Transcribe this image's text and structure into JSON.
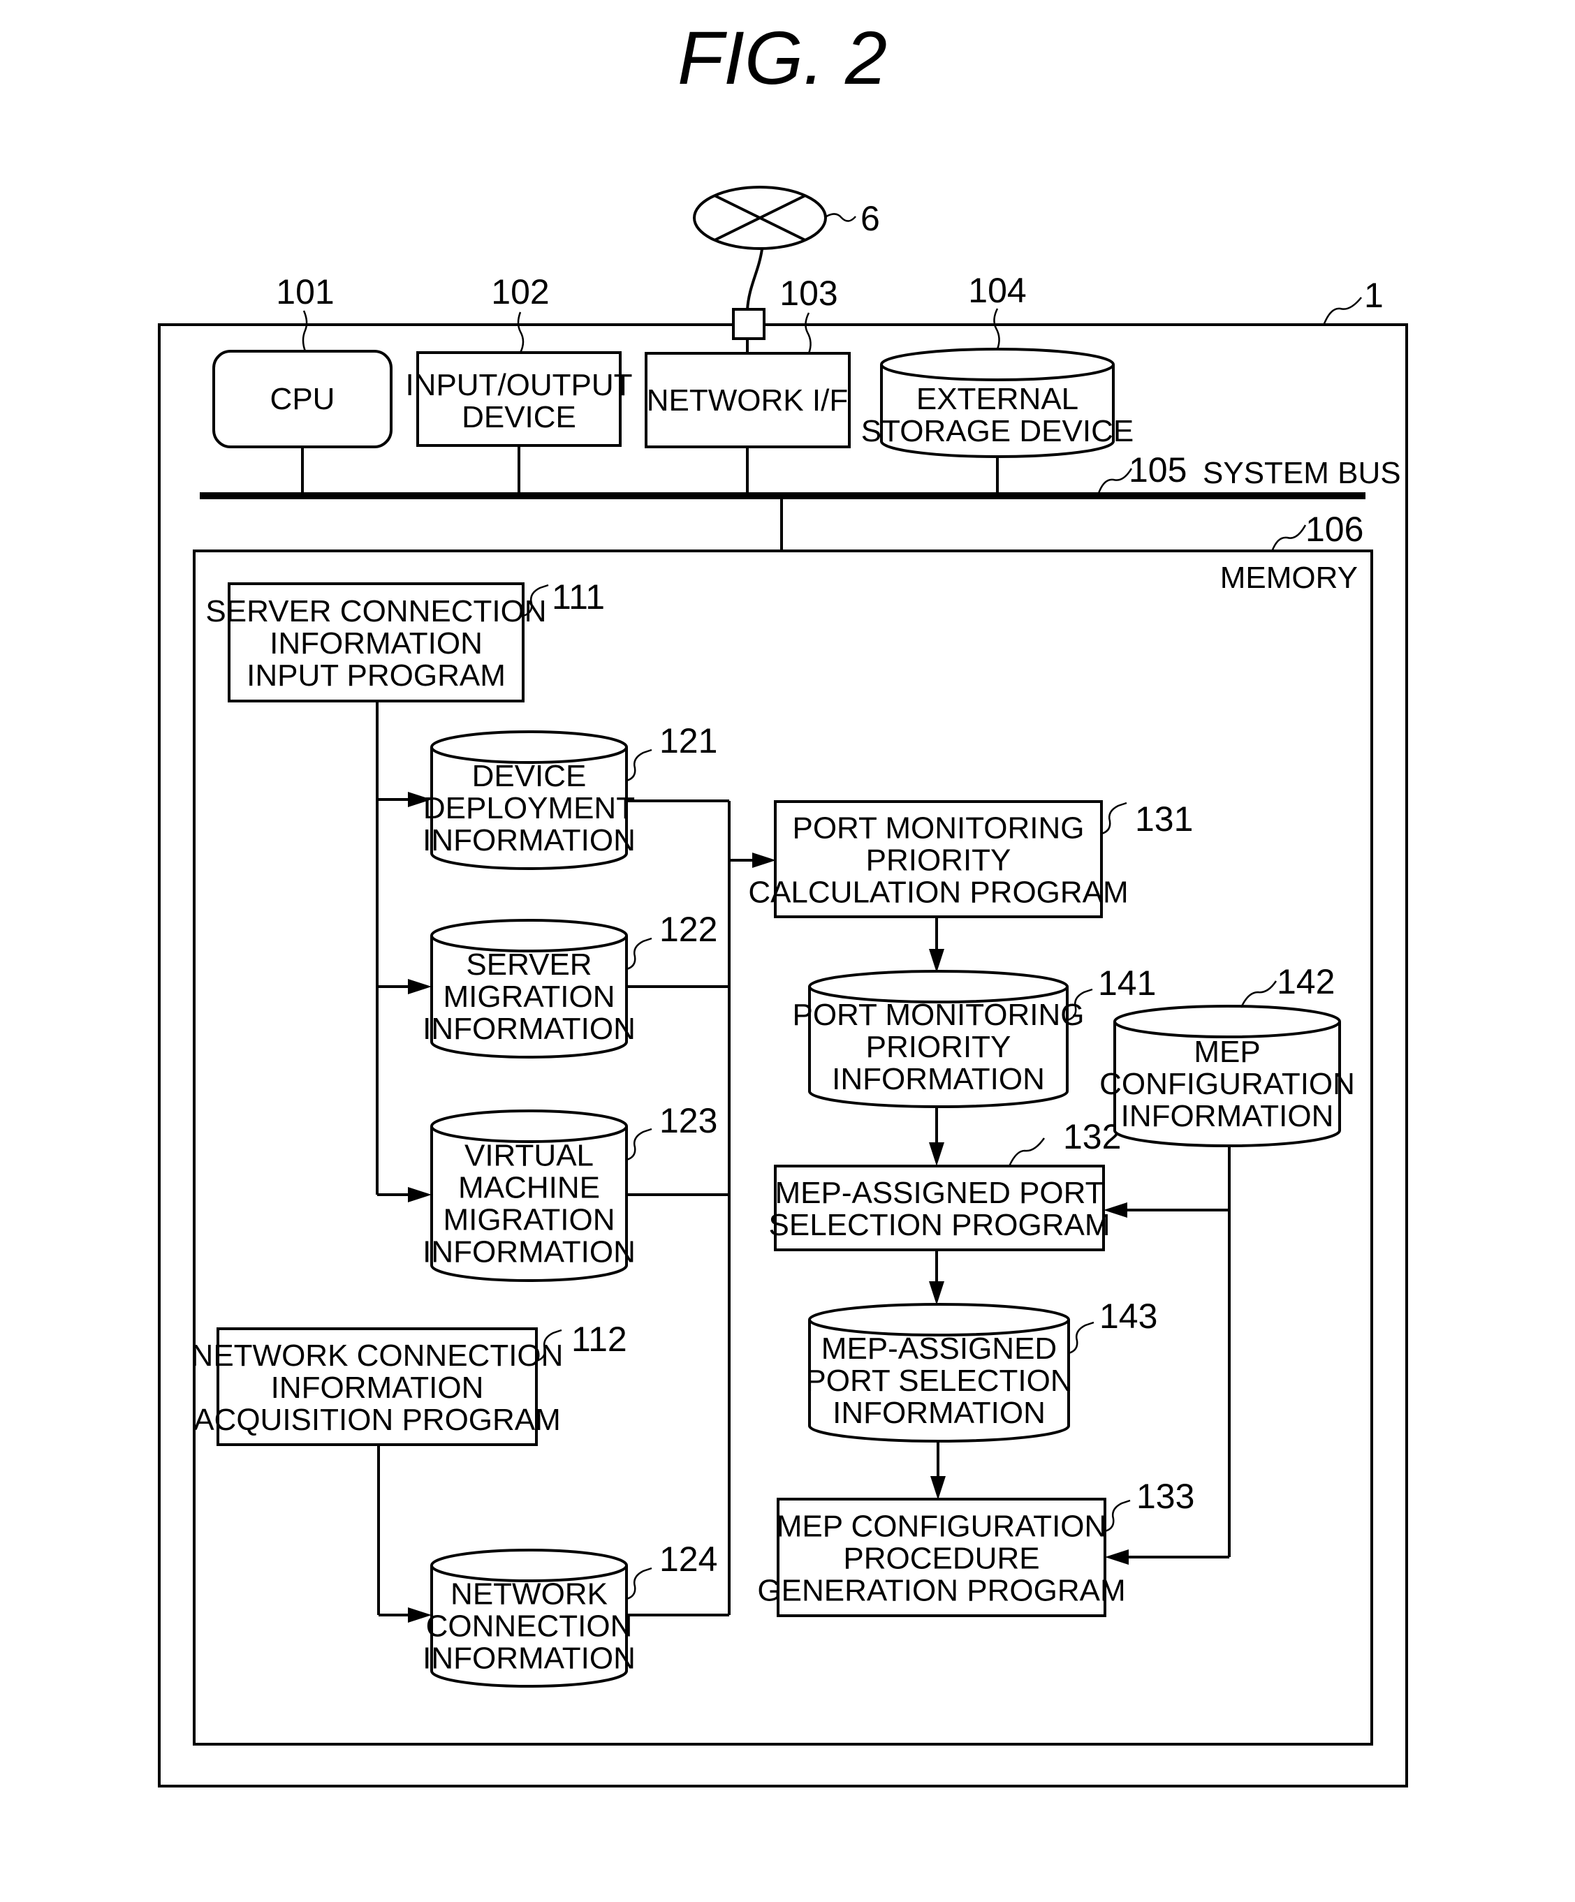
{
  "figure": {
    "title": "FIG.  2"
  },
  "colors": {
    "ink": "#000000",
    "paper": "#ffffff"
  },
  "network": {
    "ref": "6",
    "icon": "network-cloud-x-icon"
  },
  "computer": {
    "ref": "1"
  },
  "hardware": {
    "cpu": {
      "ref": "101",
      "lines": [
        "CPU"
      ]
    },
    "io": {
      "ref": "102",
      "lines": [
        "INPUT/OUTPUT",
        "DEVICE"
      ]
    },
    "nic": {
      "ref": "103",
      "lines": [
        "NETWORK I/F"
      ]
    },
    "storage": {
      "ref": "104",
      "lines": [
        "EXTERNAL",
        "STORAGE DEVICE"
      ]
    },
    "bus": {
      "ref": "105",
      "label": "SYSTEM BUS"
    }
  },
  "memory": {
    "ref": "106",
    "label": "MEMORY",
    "programs": {
      "p111": {
        "ref": "111",
        "lines": [
          "SERVER CONNECTION",
          "INFORMATION",
          "INPUT PROGRAM"
        ]
      },
      "p112": {
        "ref": "112",
        "lines": [
          "NETWORK CONNECTION",
          "INFORMATION",
          "ACQUISITION PROGRAM"
        ]
      },
      "p131": {
        "ref": "131",
        "lines": [
          "PORT MONITORING",
          "PRIORITY",
          "CALCULATION PROGRAM"
        ]
      },
      "p132": {
        "ref": "132",
        "lines": [
          "MEP-ASSIGNED PORT",
          "SELECTION PROGRAM"
        ]
      },
      "p133": {
        "ref": "133",
        "lines": [
          "MEP CONFIGURATION",
          "PROCEDURE",
          "GENERATION PROGRAM"
        ]
      }
    },
    "stores": {
      "d121": {
        "ref": "121",
        "lines": [
          "DEVICE",
          "DEPLOYMENT",
          "INFORMATION"
        ]
      },
      "d122": {
        "ref": "122",
        "lines": [
          "SERVER",
          "MIGRATION",
          "INFORMATION"
        ]
      },
      "d123": {
        "ref": "123",
        "lines": [
          "VIRTUAL",
          "MACHINE",
          "MIGRATION",
          "INFORMATION"
        ]
      },
      "d124": {
        "ref": "124",
        "lines": [
          "NETWORK",
          "CONNECTION",
          "INFORMATION"
        ]
      },
      "d141": {
        "ref": "141",
        "lines": [
          "PORT MONITORING",
          "PRIORITY",
          "INFORMATION"
        ]
      },
      "d142": {
        "ref": "142",
        "lines": [
          "MEP",
          "CONFIGURATION",
          "INFORMATION"
        ]
      },
      "d143": {
        "ref": "143",
        "lines": [
          "MEP-ASSIGNED",
          "PORT SELECTION",
          "INFORMATION"
        ]
      }
    }
  }
}
